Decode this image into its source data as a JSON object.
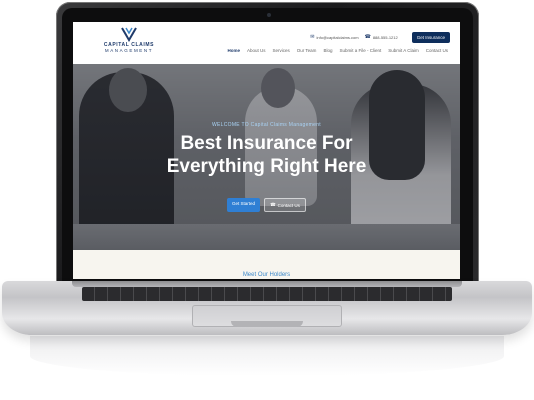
{
  "site": {
    "logo": {
      "name": "CAPITAL CLAIMS",
      "sub": "MANAGEMENT"
    },
    "contact": {
      "email": "info@capitalclaims.com",
      "phone": "888-555-1212"
    },
    "cta": "Get Insurance",
    "nav": [
      "Home",
      "About Us",
      "Services",
      "Our Team",
      "Blog",
      "Submit a File - Client",
      "Submit A Claim",
      "Contact Us"
    ]
  },
  "hero": {
    "kicker": "WELCOME TO Capital Claims Management",
    "title_line1": "Best Insurance For",
    "title_line2": "Everything Right Here",
    "primary_button": "Get Started",
    "secondary_button": "Contact Us"
  },
  "section": {
    "title": "Meet Our Holders"
  },
  "colors": {
    "brand_navy": "#0e2e5c",
    "accent_blue": "#2f7fd4",
    "kicker_blue": "#a9d2f5"
  },
  "icons": {
    "email": "envelope-icon",
    "phone": "phone-icon",
    "contact": "phone-icon"
  }
}
